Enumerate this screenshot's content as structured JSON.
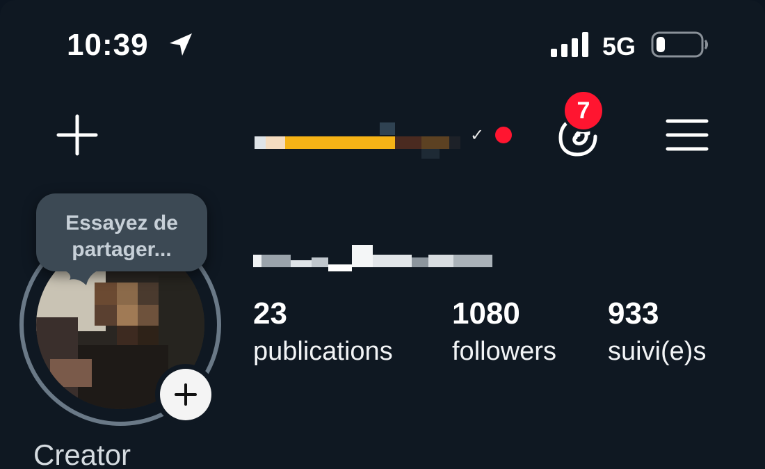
{
  "status_bar": {
    "time": "10:39",
    "network": "5G",
    "battery_level": 0.15
  },
  "header": {
    "threads_badge_count": "7",
    "verified_mark": "✓",
    "status_dot_color": "#ff1530"
  },
  "profile": {
    "tooltip_text": "Essayez de partager...",
    "stats": [
      {
        "value": "23",
        "label": "publications"
      },
      {
        "value": "1080",
        "label": "followers"
      },
      {
        "value": "933",
        "label": "suivi(e)s"
      }
    ],
    "category": "Creator"
  },
  "icons": {
    "create": "plus-icon",
    "location": "location-arrow-icon",
    "signal": "signal-bars-icon",
    "battery": "battery-icon",
    "threads": "threads-icon",
    "menu": "hamburger-menu-icon",
    "avatar_add": "plus-icon"
  },
  "colors": {
    "background": "#0f1822",
    "badge": "#ff1530",
    "text": "#f2f4f6",
    "bubble": "#3c4954"
  }
}
